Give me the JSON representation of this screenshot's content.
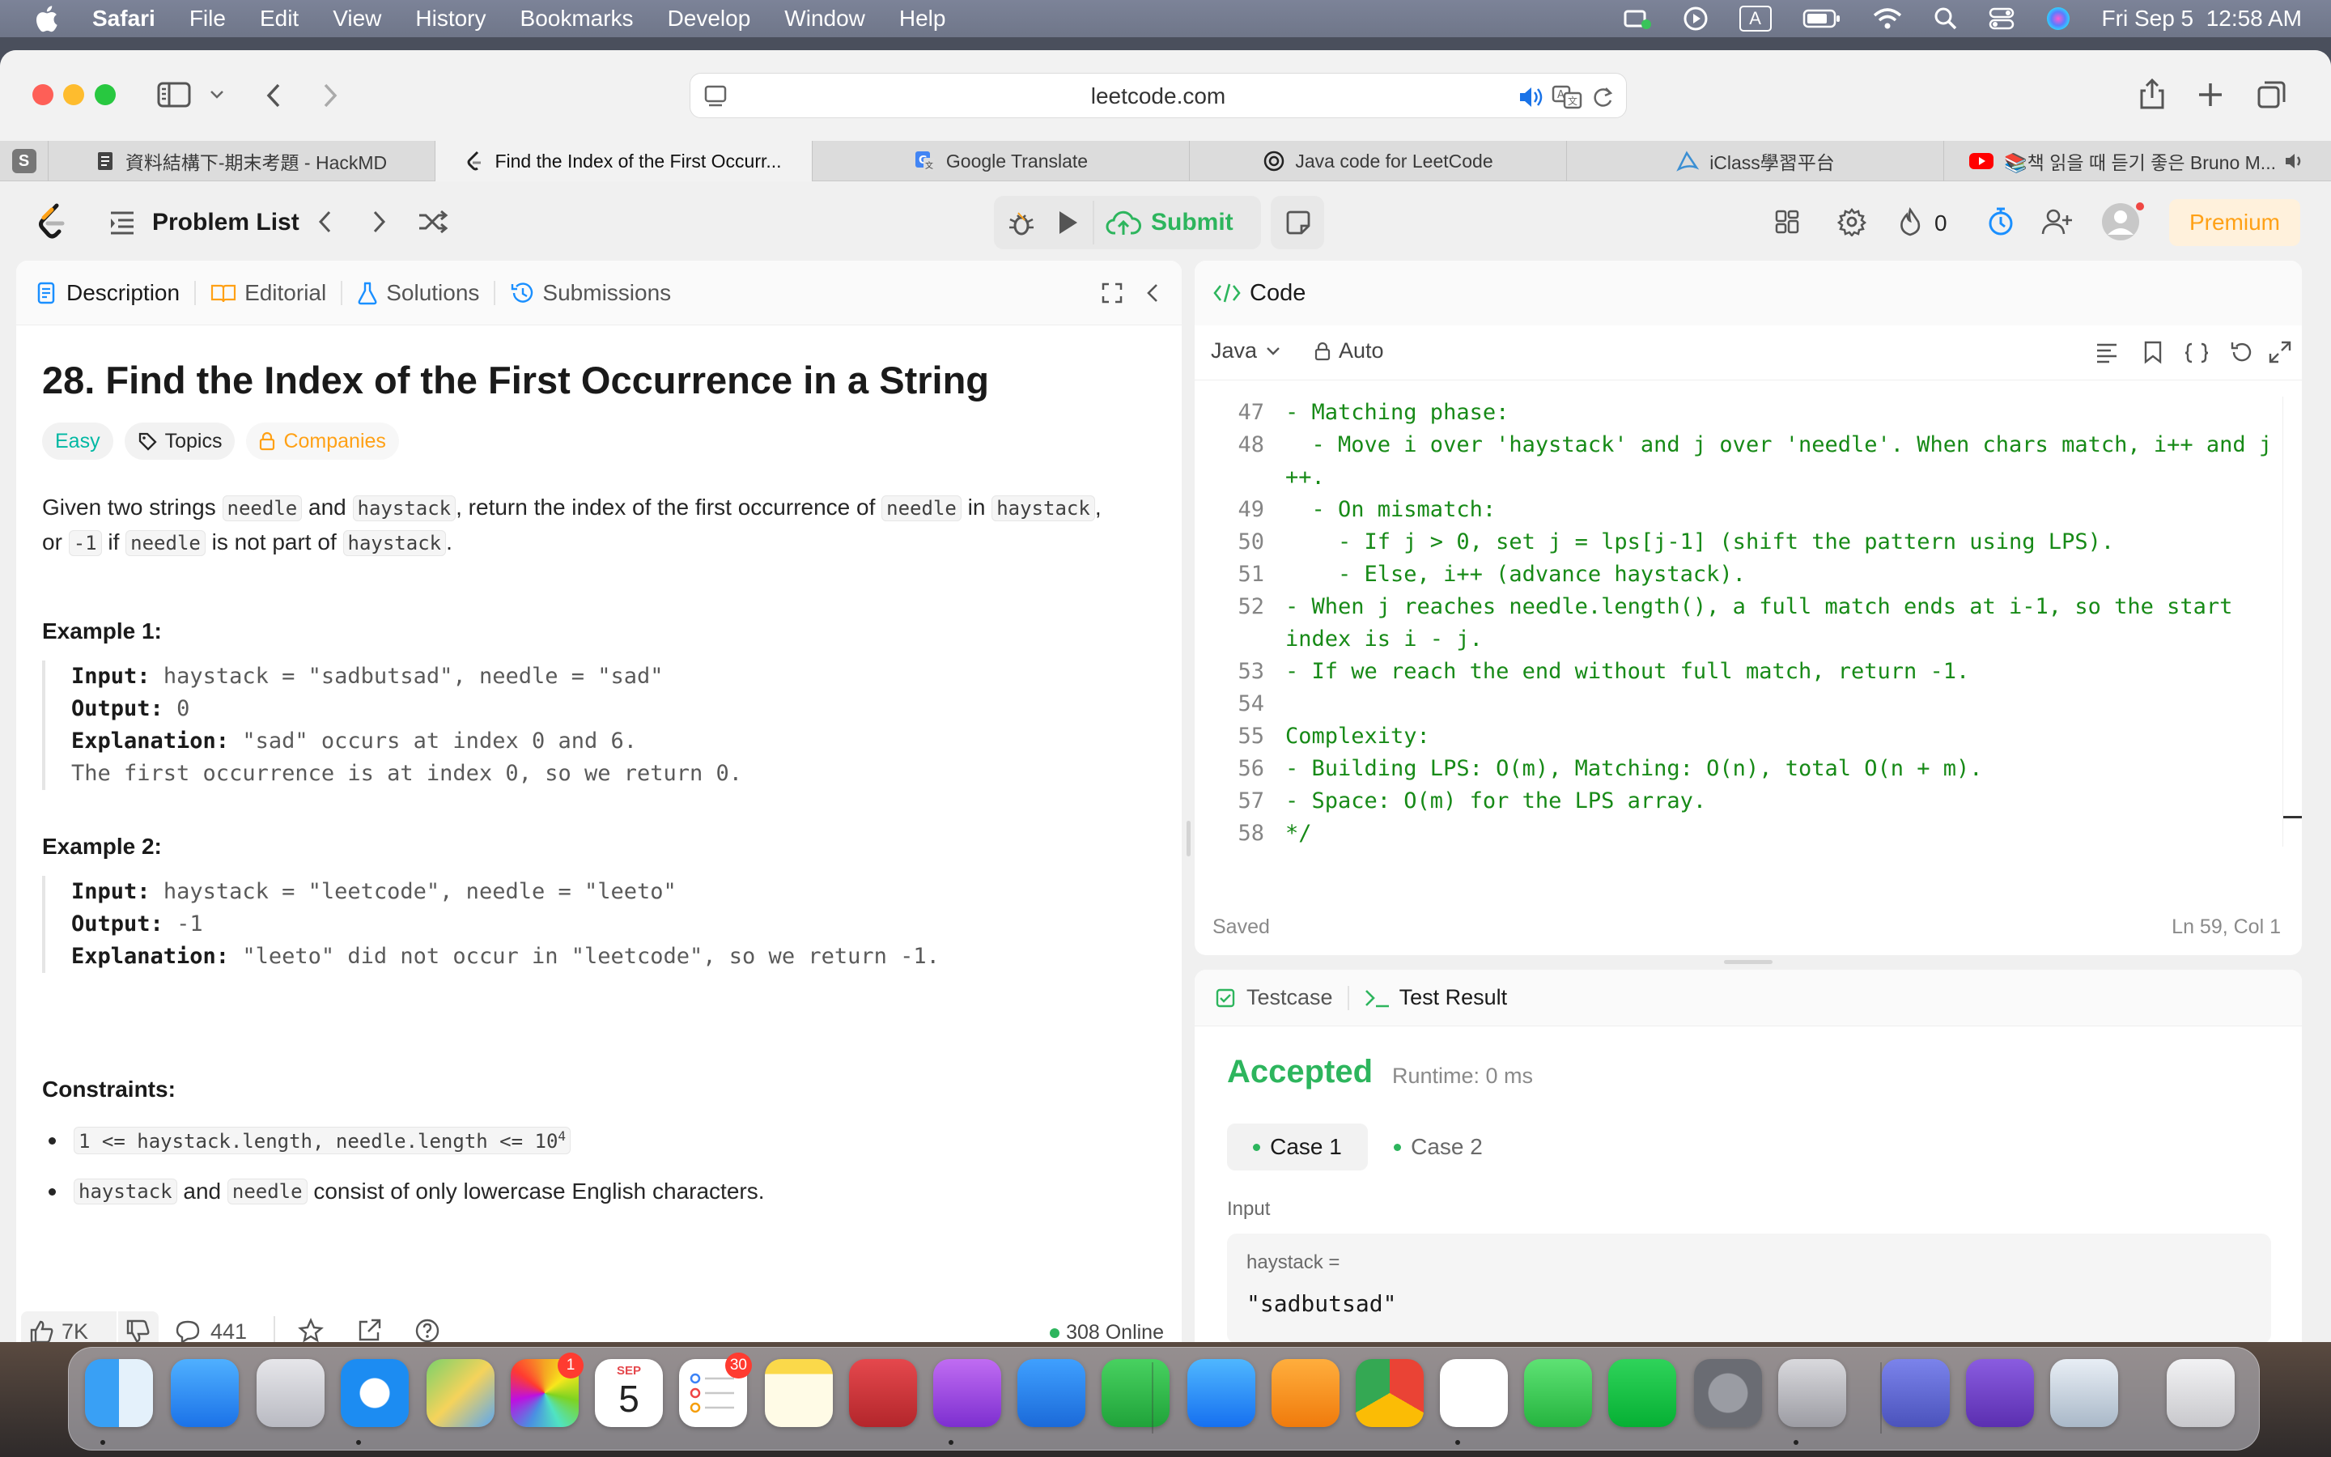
{
  "menubar": {
    "app": "Safari",
    "items": [
      "File",
      "Edit",
      "View",
      "History",
      "Bookmarks",
      "Develop",
      "Window",
      "Help"
    ],
    "datetime": "Fri Sep 5  12:58 AM",
    "input_source": "A"
  },
  "browser": {
    "url": "leetcode.com",
    "tabs": [
      {
        "label": "資料結構下-期末考題 - HackMD",
        "favicon": "hackmd-icon"
      },
      {
        "label": "Find the Index of the First Occurr...",
        "favicon": "leetcode-icon",
        "active": true
      },
      {
        "label": "Google Translate",
        "favicon": "google-translate-icon"
      },
      {
        "label": "Java code for LeetCode",
        "favicon": "chatgpt-icon"
      },
      {
        "label": "iClass學習平台",
        "favicon": "iclass-icon"
      },
      {
        "label": "📚책 읽을 때 듣기 좋은 Bruno M...",
        "favicon": "youtube-icon"
      }
    ],
    "pinned_tab": "S"
  },
  "lcnav": {
    "problem_list": "Problem List",
    "submit": "Submit",
    "streak": "0",
    "premium": "Premium"
  },
  "description": {
    "tabs": [
      "Description",
      "Editorial",
      "Solutions",
      "Submissions"
    ],
    "title": "28. Find the Index of the First Occurrence in a String",
    "difficulty": "Easy",
    "topics": "Topics",
    "companies": "Companies",
    "statement": {
      "p1": "Given two strings ",
      "c1": "needle",
      "p2": " and ",
      "c2": "haystack",
      "p3": ", return the index of the first occurrence of ",
      "c3": "needle",
      "p4": " in ",
      "c4": "haystack",
      "p5": ",",
      "p6": "or ",
      "c5": "-1",
      "p7": " if ",
      "c6": "needle",
      "p8": " is not part of ",
      "c7": "haystack",
      "p9": "."
    },
    "examples": [
      {
        "heading": "Example 1:",
        "input": "haystack = \"sadbutsad\", needle = \"sad\"",
        "output": "0",
        "explanation": "\"sad\" occurs at index 0 and 6.",
        "explanation2": "The first occurrence is at index 0, so we return 0."
      },
      {
        "heading": "Example 2:",
        "input": "haystack = \"leetcode\", needle = \"leeto\"",
        "output": "-1",
        "explanation": "\"leeto\" did not occur in \"leetcode\", so we return -1."
      }
    ],
    "labels": {
      "input": "Input:",
      "output": "Output:",
      "explanation": "Explanation:"
    },
    "constraints_heading": "Constraints:",
    "constraint1_code": "1 <= haystack.length, needle.length <= 10",
    "constraint1_sup": "4",
    "constraint2_c1": "haystack",
    "constraint2_mid": " and ",
    "constraint2_c2": "needle",
    "constraint2_rest": " consist of only lowercase English characters.",
    "footer": {
      "likes": "7K",
      "comments": "441",
      "online": "308 Online"
    }
  },
  "code": {
    "title": "Code",
    "language": "Java",
    "mode": "Auto",
    "status": "Saved",
    "cursor": "Ln 59, Col 1",
    "lines": [
      {
        "n": "47",
        "text": "- Matching phase:"
      },
      {
        "n": "48",
        "text": "  - Move i over 'haystack' and j over 'needle'. When chars match, i++ and j"
      },
      {
        "n": "",
        "text": "++."
      },
      {
        "n": "49",
        "text": "  - On mismatch:"
      },
      {
        "n": "50",
        "text": "    - If j > 0, set j = lps[j-1] (shift the pattern using LPS)."
      },
      {
        "n": "51",
        "text": "    - Else, i++ (advance haystack)."
      },
      {
        "n": "52",
        "text": "- When j reaches needle.length(), a full match ends at i-1, so the start"
      },
      {
        "n": "",
        "text": "index is i - j."
      },
      {
        "n": "53",
        "text": "- If we reach the end without full match, return -1."
      },
      {
        "n": "54",
        "text": ""
      },
      {
        "n": "55",
        "text": "Complexity:"
      },
      {
        "n": "56",
        "text": "- Building LPS: O(m), Matching: O(n), total O(n + m)."
      },
      {
        "n": "57",
        "text": "- Space: O(m) for the LPS array."
      },
      {
        "n": "58",
        "text": "*/"
      }
    ]
  },
  "result": {
    "tabs": [
      "Testcase",
      "Test Result"
    ],
    "status": "Accepted",
    "runtime": "Runtime: 0 ms",
    "cases": [
      "Case 1",
      "Case 2"
    ],
    "input_label": "Input",
    "var_label": "haystack =",
    "var_value": "\"sadbutsad\""
  },
  "dock": {
    "badges": {
      "photos": "1",
      "calendar_month": "SEP",
      "calendar_day": "5",
      "reminders": "30"
    }
  },
  "colors": {
    "accepted": "#2db55d",
    "submit": "#2db55d",
    "premium": "#ffa116",
    "easy": "#00b8a3",
    "comment_green": "#178a17"
  }
}
